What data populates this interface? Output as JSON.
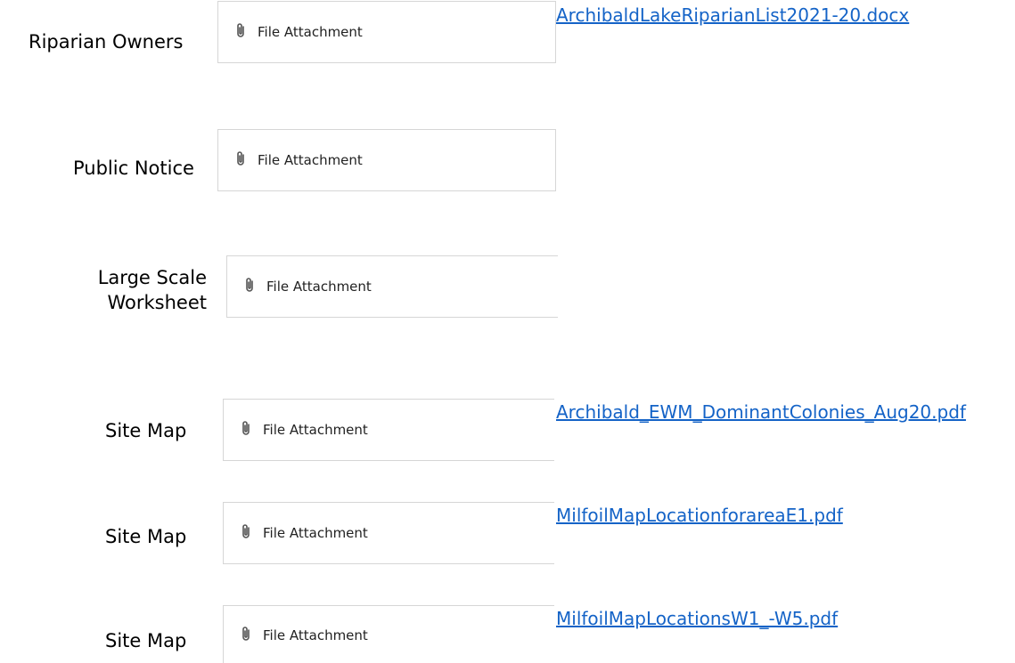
{
  "rows": [
    {
      "label": "Riparian Owners",
      "attachment_label": "File Attachment",
      "link": "ArchibaldLakeRiparianList2021-20.docx"
    },
    {
      "label": "Public Notice",
      "attachment_label": "File Attachment",
      "link": ""
    },
    {
      "label_lines": [
        "Large Scale",
        "Worksheet"
      ],
      "attachment_label": "File Attachment",
      "link": ""
    },
    {
      "label": "Site Map",
      "attachment_label": "File Attachment",
      "link": "Archibald_EWM_DominantColonies_Aug20.pdf"
    },
    {
      "label": "Site Map",
      "attachment_label": "File Attachment",
      "link": "MilfoilMapLocationforareaE1.pdf"
    },
    {
      "label": "Site Map",
      "attachment_label": "File Attachment",
      "link": "MilfoilMapLocationsW1_-W5.pdf"
    }
  ],
  "icons": {
    "attachment": "paperclip-icon"
  },
  "colors": {
    "link": "#1463c7",
    "border": "#d6d6d6"
  }
}
